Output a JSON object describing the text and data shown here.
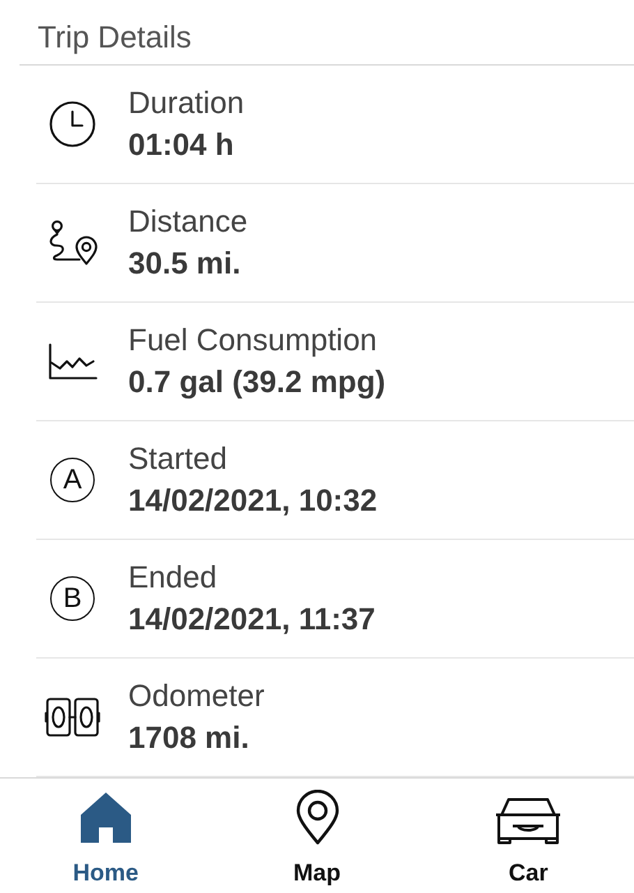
{
  "header": {
    "title": "Trip Details"
  },
  "rows": [
    {
      "kind": "clock",
      "label": "Duration",
      "value": "01:04 h"
    },
    {
      "kind": "route",
      "label": "Distance",
      "value": "30.5 mi."
    },
    {
      "kind": "chart",
      "label": "Fuel Consumption",
      "value": "0.7 gal (39.2 mpg)"
    },
    {
      "kind": "letter",
      "letter": "A",
      "label": "Started",
      "value": "14/02/2021, 10:32"
    },
    {
      "kind": "letter",
      "letter": "B",
      "label": "Ended",
      "value": "14/02/2021, 11:37"
    },
    {
      "kind": "odometer",
      "label": "Odometer",
      "value": "1708 mi."
    }
  ],
  "tabs": [
    {
      "kind": "home",
      "label": "Home",
      "selected": true
    },
    {
      "kind": "pin",
      "label": "Map",
      "selected": false
    },
    {
      "kind": "car",
      "label": "Car",
      "selected": false
    }
  ]
}
